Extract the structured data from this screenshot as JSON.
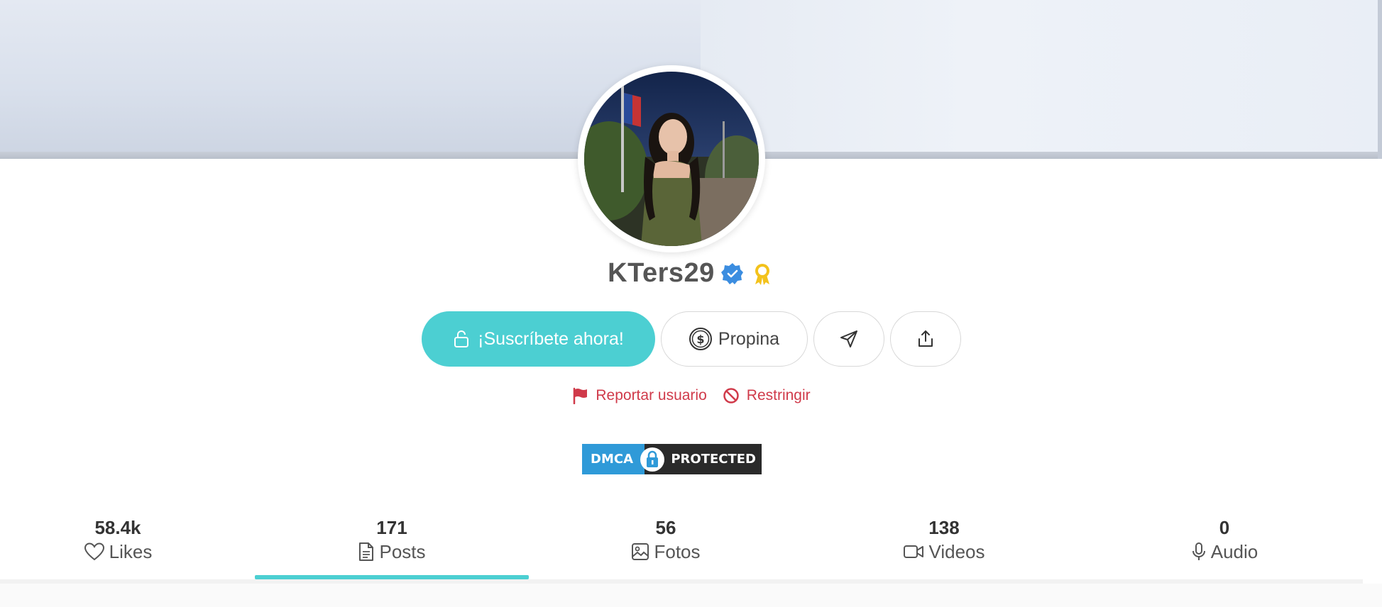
{
  "profile": {
    "username": "KTers29",
    "verified_icon": "verified-badge-icon",
    "award_icon": "award-ribbon-icon"
  },
  "actions": {
    "subscribe_label": "¡Suscríbete ahora!",
    "tip_label": "Propina",
    "message_icon": "send-icon",
    "share_icon": "share-icon"
  },
  "links": {
    "report_label": "Reportar usuario",
    "restrict_label": "Restringir"
  },
  "dmca": {
    "left_text": "DMCA",
    "right_text": "PROTECTED"
  },
  "stats": [
    {
      "value": "58.4k",
      "label": "Likes",
      "icon": "heart-icon"
    },
    {
      "value": "171",
      "label": "Posts",
      "icon": "document-icon"
    },
    {
      "value": "56",
      "label": "Fotos",
      "icon": "image-icon"
    },
    {
      "value": "138",
      "label": "Videos",
      "icon": "video-icon"
    },
    {
      "value": "0",
      "label": "Audio",
      "icon": "microphone-icon"
    }
  ],
  "active_tab": "Posts",
  "colors": {
    "accent": "#4ccfd2",
    "danger": "#d03a4a",
    "verified": "#3b8de0",
    "award": "#f3c21b"
  }
}
